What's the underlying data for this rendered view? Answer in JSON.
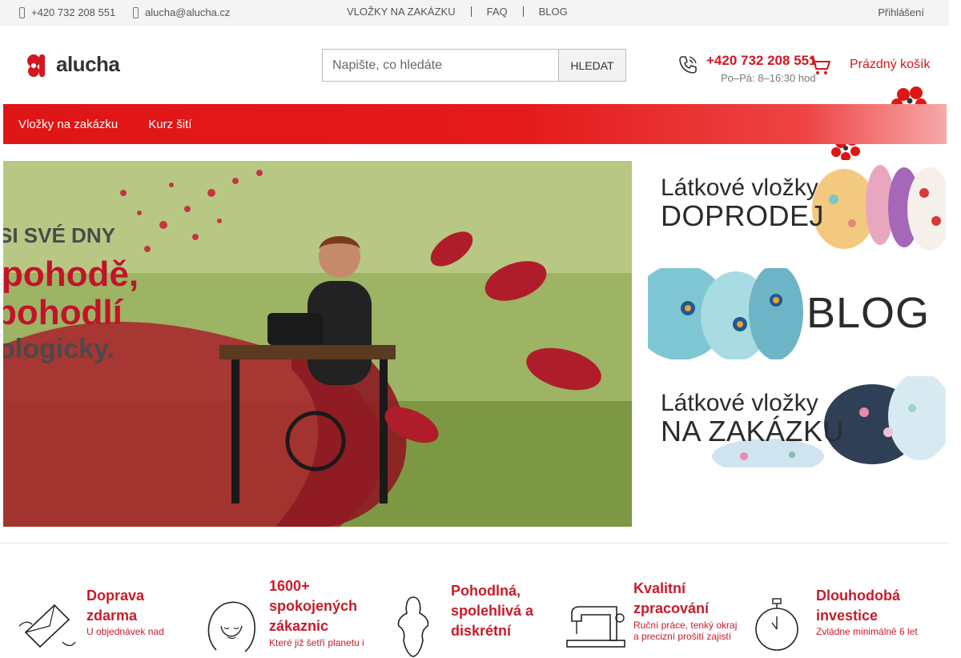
{
  "topbar": {
    "phone": "+420 732 208 551",
    "email": "alucha@alucha.cz",
    "nav": [
      "VLOŽKY NA ZAKÁZKU",
      "FAQ",
      "BLOG"
    ],
    "login": "Přihlášení"
  },
  "header": {
    "logo_text": "alucha",
    "search_placeholder": "Napište, co hledáte",
    "search_button": "HLEDAT",
    "hotline_number": "+420 732 208 551",
    "hotline_hours": "Po–Pá: 8–16:30 hod",
    "cart_label": "Prázdný košík"
  },
  "mainnav": {
    "items": [
      "Vložky na zakázku",
      "Kurz šití"
    ]
  },
  "hero": {
    "line1": "SI SVÉ DNY",
    "line2": "pohodě,",
    "line3": "pohodlí",
    "line4": "ologicky."
  },
  "banners": [
    {
      "small": "Látkové vložky",
      "big": "DOPRODEJ"
    },
    {
      "small": "",
      "big": "BLOG"
    },
    {
      "small": "Látkové vložky",
      "big": "NA ZAKÁZKU"
    }
  ],
  "features": [
    {
      "title": "Doprava zdarma",
      "desc": "U objednávek nad",
      "icon": "envelope-wings-icon"
    },
    {
      "title": "1600+ spokojených zákaznic",
      "desc": "Které již šetří planetu i",
      "icon": "woman-face-icon"
    },
    {
      "title": "Pohodlná, spolehlivá a diskrétní",
      "desc": "",
      "icon": "pad-icon"
    },
    {
      "title": "Kvalitní zpracování",
      "desc": "Ruční práce, tenký okraj a precizní prošití zajistí",
      "icon": "sewing-machine-icon"
    },
    {
      "title": "Dlouhodobá investice",
      "desc": "Zvládne minimálně 6 let",
      "icon": "stopwatch-icon"
    }
  ],
  "colors": {
    "accent": "#d31621",
    "nav_red": "#e01515"
  }
}
